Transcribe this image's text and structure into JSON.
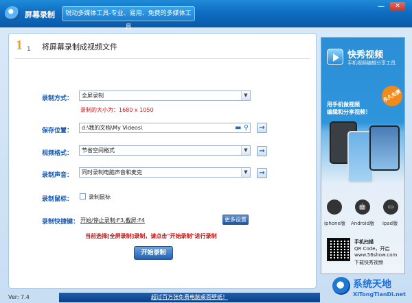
{
  "titlebar": {
    "app_title": "屏幕录制",
    "slogan": "锐动多媒体工具-专业、易用、免费的多媒体工具",
    "min": "—",
    "close": "✕"
  },
  "step": {
    "number": "1",
    "sub": "1",
    "title": "将屏幕录制成视频文件"
  },
  "form": {
    "record_mode_label": "录制方式：",
    "record_mode_value": "全屏录制",
    "record_size_note": "录制的大小为：1680 x 1050",
    "save_label": "保存位置：",
    "save_value": "d:\\我的文档\\My Videos\\",
    "format_label": "视频格式：",
    "format_value": "节省空间格式",
    "sound_label": "录制声音：",
    "sound_value": "同时录制电脑声音和麦克",
    "mouse_label": "录制鼠标：",
    "mouse_checkbox_label": "录制鼠标",
    "hotkey_label": "录制快捷键：",
    "hotkey_value": "开始/停止录制:F3,截屏:F4",
    "more_settings": "更多设置",
    "hint": "当前选择[全屏录制]录制，请点击\"开始录制\"进行录制",
    "start_button": "开始录制",
    "go_arrow": "→"
  },
  "ad": {
    "brand": "快秀视频",
    "sub": "手机视频编辑分享工具",
    "ribbon": "永久免费",
    "slogan_line1": "用手机做视频",
    "slogan_line2": "编辑和分享视频！",
    "platforms": [
      {
        "label": "iphone版",
        "icon": ""
      },
      {
        "label": "Android版",
        "icon": "🤖"
      },
      {
        "label": "ipad版",
        "icon": "▭"
      }
    ],
    "qr_line1": "手机扫描",
    "qr_line2": "QR Code，开启",
    "qr_line3": "www.56show.com",
    "qr_line4": "下载快秀视频"
  },
  "footer": {
    "version": "Ver: 7.4",
    "banner": "超过百万张免费电脑桌面壁纸！"
  },
  "watermark": {
    "title": "系统天地",
    "sub": "XiTongTianDi.net"
  }
}
